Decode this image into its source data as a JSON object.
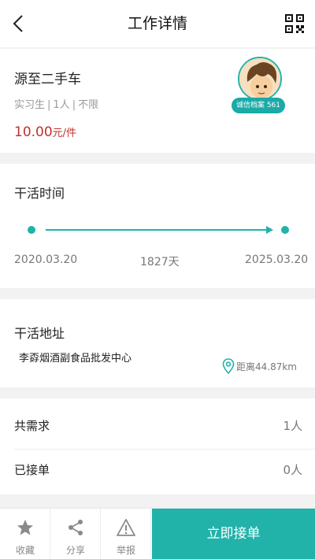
{
  "nav": {
    "title": "工作详情"
  },
  "job": {
    "title": "源至二手车",
    "meta": [
      "实习生",
      "1人",
      "不限"
    ],
    "price": "10.00",
    "price_unit": "元/件",
    "credit_badge": "诚信档案 561"
  },
  "work_time": {
    "title": "干活时间",
    "start": "2020.03.20",
    "duration": "1827天",
    "end": "2025.03.20"
  },
  "work_address": {
    "title": "干活地址",
    "address": "李孬烟酒副食品批发中心",
    "distance": "距离44.87km"
  },
  "requirements": [
    {
      "label": "共需求",
      "value": "1人"
    },
    {
      "label": "已接单",
      "value": "0人"
    }
  ],
  "bottom_bar": {
    "favorite": "收藏",
    "share": "分享",
    "report": "举报",
    "accept": "立即接单"
  },
  "colors": {
    "accent": "#21b2aa",
    "price": "#c0322d"
  },
  "icons": [
    "back-icon",
    "qr-code-icon",
    "location-pin-icon",
    "star-icon",
    "share-icon",
    "warning-icon"
  ]
}
